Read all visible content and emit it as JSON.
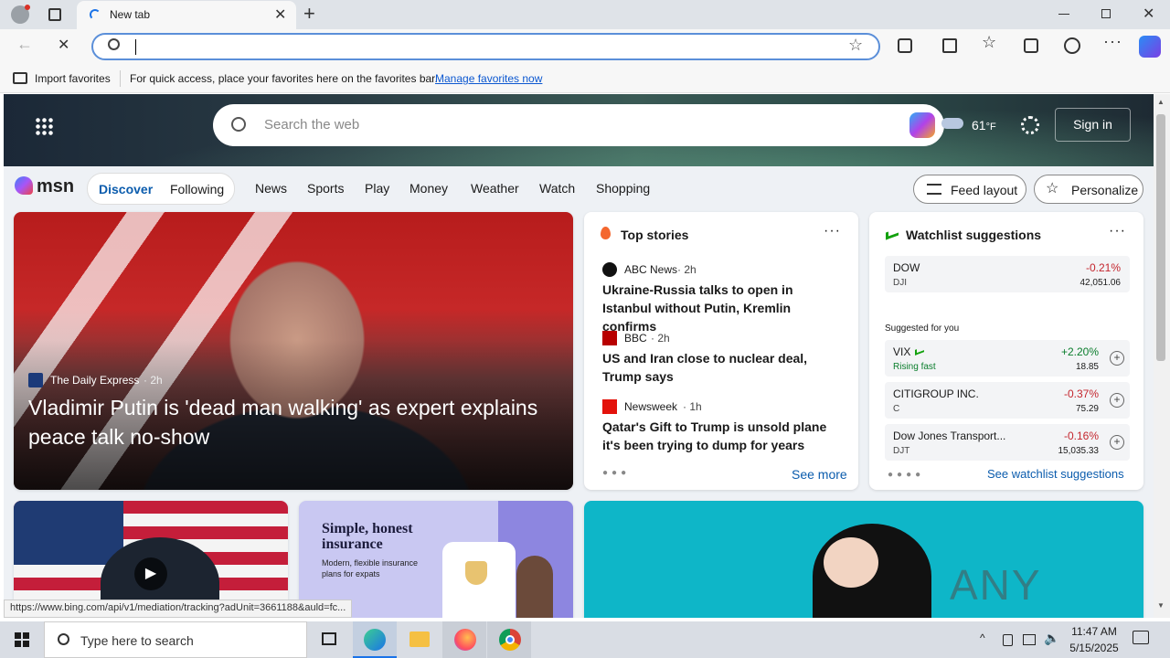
{
  "browser": {
    "tab_title": "New tab",
    "address_value": "",
    "status_url": "https://www.bing.com/api/v1/mediation/tracking?adUnit=3661188&auld=fc..."
  },
  "favbar": {
    "import_label": "Import favorites",
    "hint": "For quick access, place your favorites here on the favorites bar.",
    "manage_link": "Manage favorites now"
  },
  "msn": {
    "search_placeholder": "Search the web",
    "temperature": "61",
    "temp_unit": "°F",
    "sign_in": "Sign in",
    "logo": "msn",
    "tabs": [
      "Discover",
      "Following"
    ],
    "nav": [
      "News",
      "Sports",
      "Play",
      "Money",
      "Weather",
      "Watch",
      "Shopping"
    ],
    "feed_layout": "Feed layout",
    "personalize": "Personalize"
  },
  "hero": {
    "source": "The Daily Express",
    "age": "· 2h",
    "headline": "Vladimir Putin is 'dead man walking' as expert explains peace talk no-show"
  },
  "top_stories": {
    "title": "Top stories",
    "see_more": "See more",
    "items": [
      {
        "source": "ABC News",
        "age": "· 2h",
        "headline": "Ukraine-Russia talks to open in Istanbul without Putin, Kremlin confirms"
      },
      {
        "source": "BBC",
        "age": "· 2h",
        "headline": "US and Iran close to nuclear deal, Trump says"
      },
      {
        "source": "Newsweek",
        "age": "· 1h",
        "headline": "Qatar's Gift to Trump is unsold plane it's been trying to dump for years"
      }
    ]
  },
  "watchlist": {
    "title": "Watchlist suggestions",
    "suggested": "Suggested for you",
    "see_link": "See watchlist suggestions",
    "dow": {
      "name": "DOW",
      "symbol": "DJI",
      "change": "-0.21%",
      "value": "42,051.06"
    },
    "items": [
      {
        "name": "VIX",
        "symbol": "Rising fast",
        "change": "+2.20%",
        "value": "18.85",
        "color": "#0a7d2c"
      },
      {
        "name": "CITIGROUP INC.",
        "symbol": "C",
        "change": "-0.37%",
        "value": "75.29",
        "color": "#c4262e"
      },
      {
        "name": "Dow Jones Transport...",
        "symbol": "DJT",
        "change": "-0.16%",
        "value": "15,035.33",
        "color": "#c4262e"
      }
    ]
  },
  "ad": {
    "title": "Simple, honest insurance",
    "subtitle": "Modern, flexible insurance plans for expats"
  },
  "watermark": "ANY RUN",
  "taskbar": {
    "search_placeholder": "Type here to search",
    "time": "11:47 AM",
    "date": "5/15/2025"
  }
}
